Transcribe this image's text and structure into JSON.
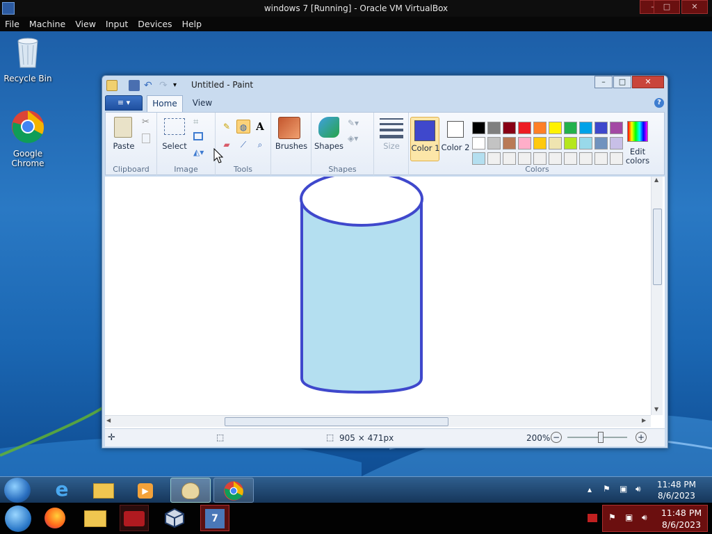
{
  "vbox": {
    "title": "windows 7 [Running] - Oracle VM VirtualBox",
    "controls": [
      "–",
      "□",
      "✕"
    ],
    "menu": [
      "File",
      "Machine",
      "View",
      "Input",
      "Devices",
      "Help"
    ]
  },
  "desktop": {
    "icons": [
      {
        "label": "Recycle Bin",
        "icon": "recycle-bin-icon"
      },
      {
        "label": "Google Chrome",
        "icon": "chrome-icon"
      }
    ]
  },
  "paint": {
    "window_title": "Untitled - Paint",
    "tabs": [
      "Home",
      "View"
    ],
    "file_button": "≡ ▾",
    "help": "?",
    "groups": {
      "clipboard": {
        "label": "Clipboard",
        "paste": "Paste"
      },
      "image": {
        "label": "Image",
        "select": "Select"
      },
      "tools": {
        "label": "Tools"
      },
      "brushes": {
        "label": "Brushes"
      },
      "shapes": {
        "label": "Shapes",
        "shapes_btn": "Shapes"
      },
      "size": {
        "label": "Size"
      },
      "colors": {
        "label": "Colors",
        "color1": "Color 1",
        "color2": "Color 2",
        "edit_colors": "Edit colors",
        "color1_value": "#3f48cc",
        "color2_value": "#ffffff",
        "palette_row1": [
          "#000000",
          "#7f7f7f",
          "#880015",
          "#ed1c24",
          "#ff7f27",
          "#fff200",
          "#22b14c",
          "#00a2e8",
          "#3f48cc",
          "#a349a4"
        ],
        "palette_row2": [
          "#ffffff",
          "#c3c3c3",
          "#b97a57",
          "#ffaec9",
          "#ffc90e",
          "#efe4b0",
          "#b5e61d",
          "#99d9ea",
          "#7092be",
          "#c8bfe7"
        ],
        "palette_row3": [
          "#b4dff0",
          "#f0f0f0",
          "#f0f0f0",
          "#f0f0f0",
          "#f0f0f0",
          "#f0f0f0",
          "#f0f0f0",
          "#f0f0f0",
          "#f0f0f0",
          "#f0f0f0"
        ]
      }
    },
    "drawing": {
      "shape": "cylinder",
      "stroke": "#3f48cc",
      "fill": "#b4dff0"
    },
    "status": {
      "dimensions": "905 × 471px",
      "zoom": "200%",
      "zoom_out": "−",
      "zoom_in": "+"
    }
  },
  "taskbar": {
    "clock_time": "11:48 PM",
    "clock_date": "8/6/2023",
    "pinned": [
      "start-orb",
      "internet-explorer",
      "file-explorer",
      "media-player",
      "paint",
      "chrome"
    ]
  },
  "host_taskbar": {
    "clock_time": "11:48 PM",
    "clock_date": "8/6/2023"
  }
}
